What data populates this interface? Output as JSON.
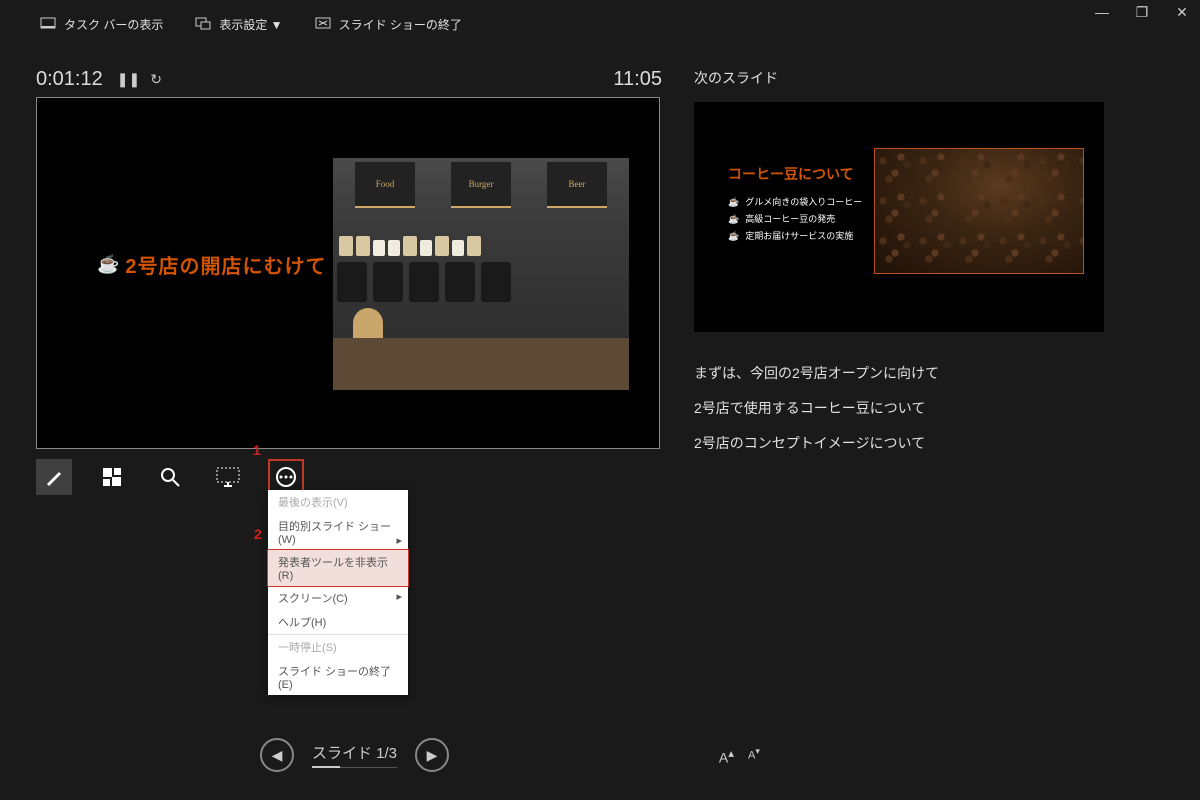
{
  "topbar": {
    "taskbar": "タスク バーの表示",
    "display": "表示設定 ▼",
    "end": "スライド ショーの終了"
  },
  "timer": {
    "elapsed": "0:01:12",
    "clock": "11:05"
  },
  "current_slide": {
    "title": "2号店の開店にむけて",
    "menu_boards": [
      "Food",
      "Burger",
      "Beer"
    ]
  },
  "callouts": {
    "c1": "1",
    "c2": "2"
  },
  "menu": {
    "last_view": "最後の表示(V)",
    "custom_show": "目的別スライド ショー(W)",
    "hide_presenter": "発表者ツールを非表示(R)",
    "screen": "スクリーン(C)",
    "help": "ヘルプ(H)",
    "pause": "一時停止(S)",
    "end_show": "スライド ショーの終了(E)"
  },
  "next": {
    "label": "次のスライド",
    "title": "コーヒー豆について",
    "bullets": [
      "グルメ向きの袋入りコーヒー",
      "高級コーヒー豆の発売",
      "定期お届けサービスの実施"
    ]
  },
  "notes": [
    "まずは、今回の2号店オープンに向けて",
    "2号店で使用するコーヒー豆について",
    "2号店のコンセプトイメージについて"
  ],
  "nav": {
    "slide_count": "スライド 1/3"
  }
}
